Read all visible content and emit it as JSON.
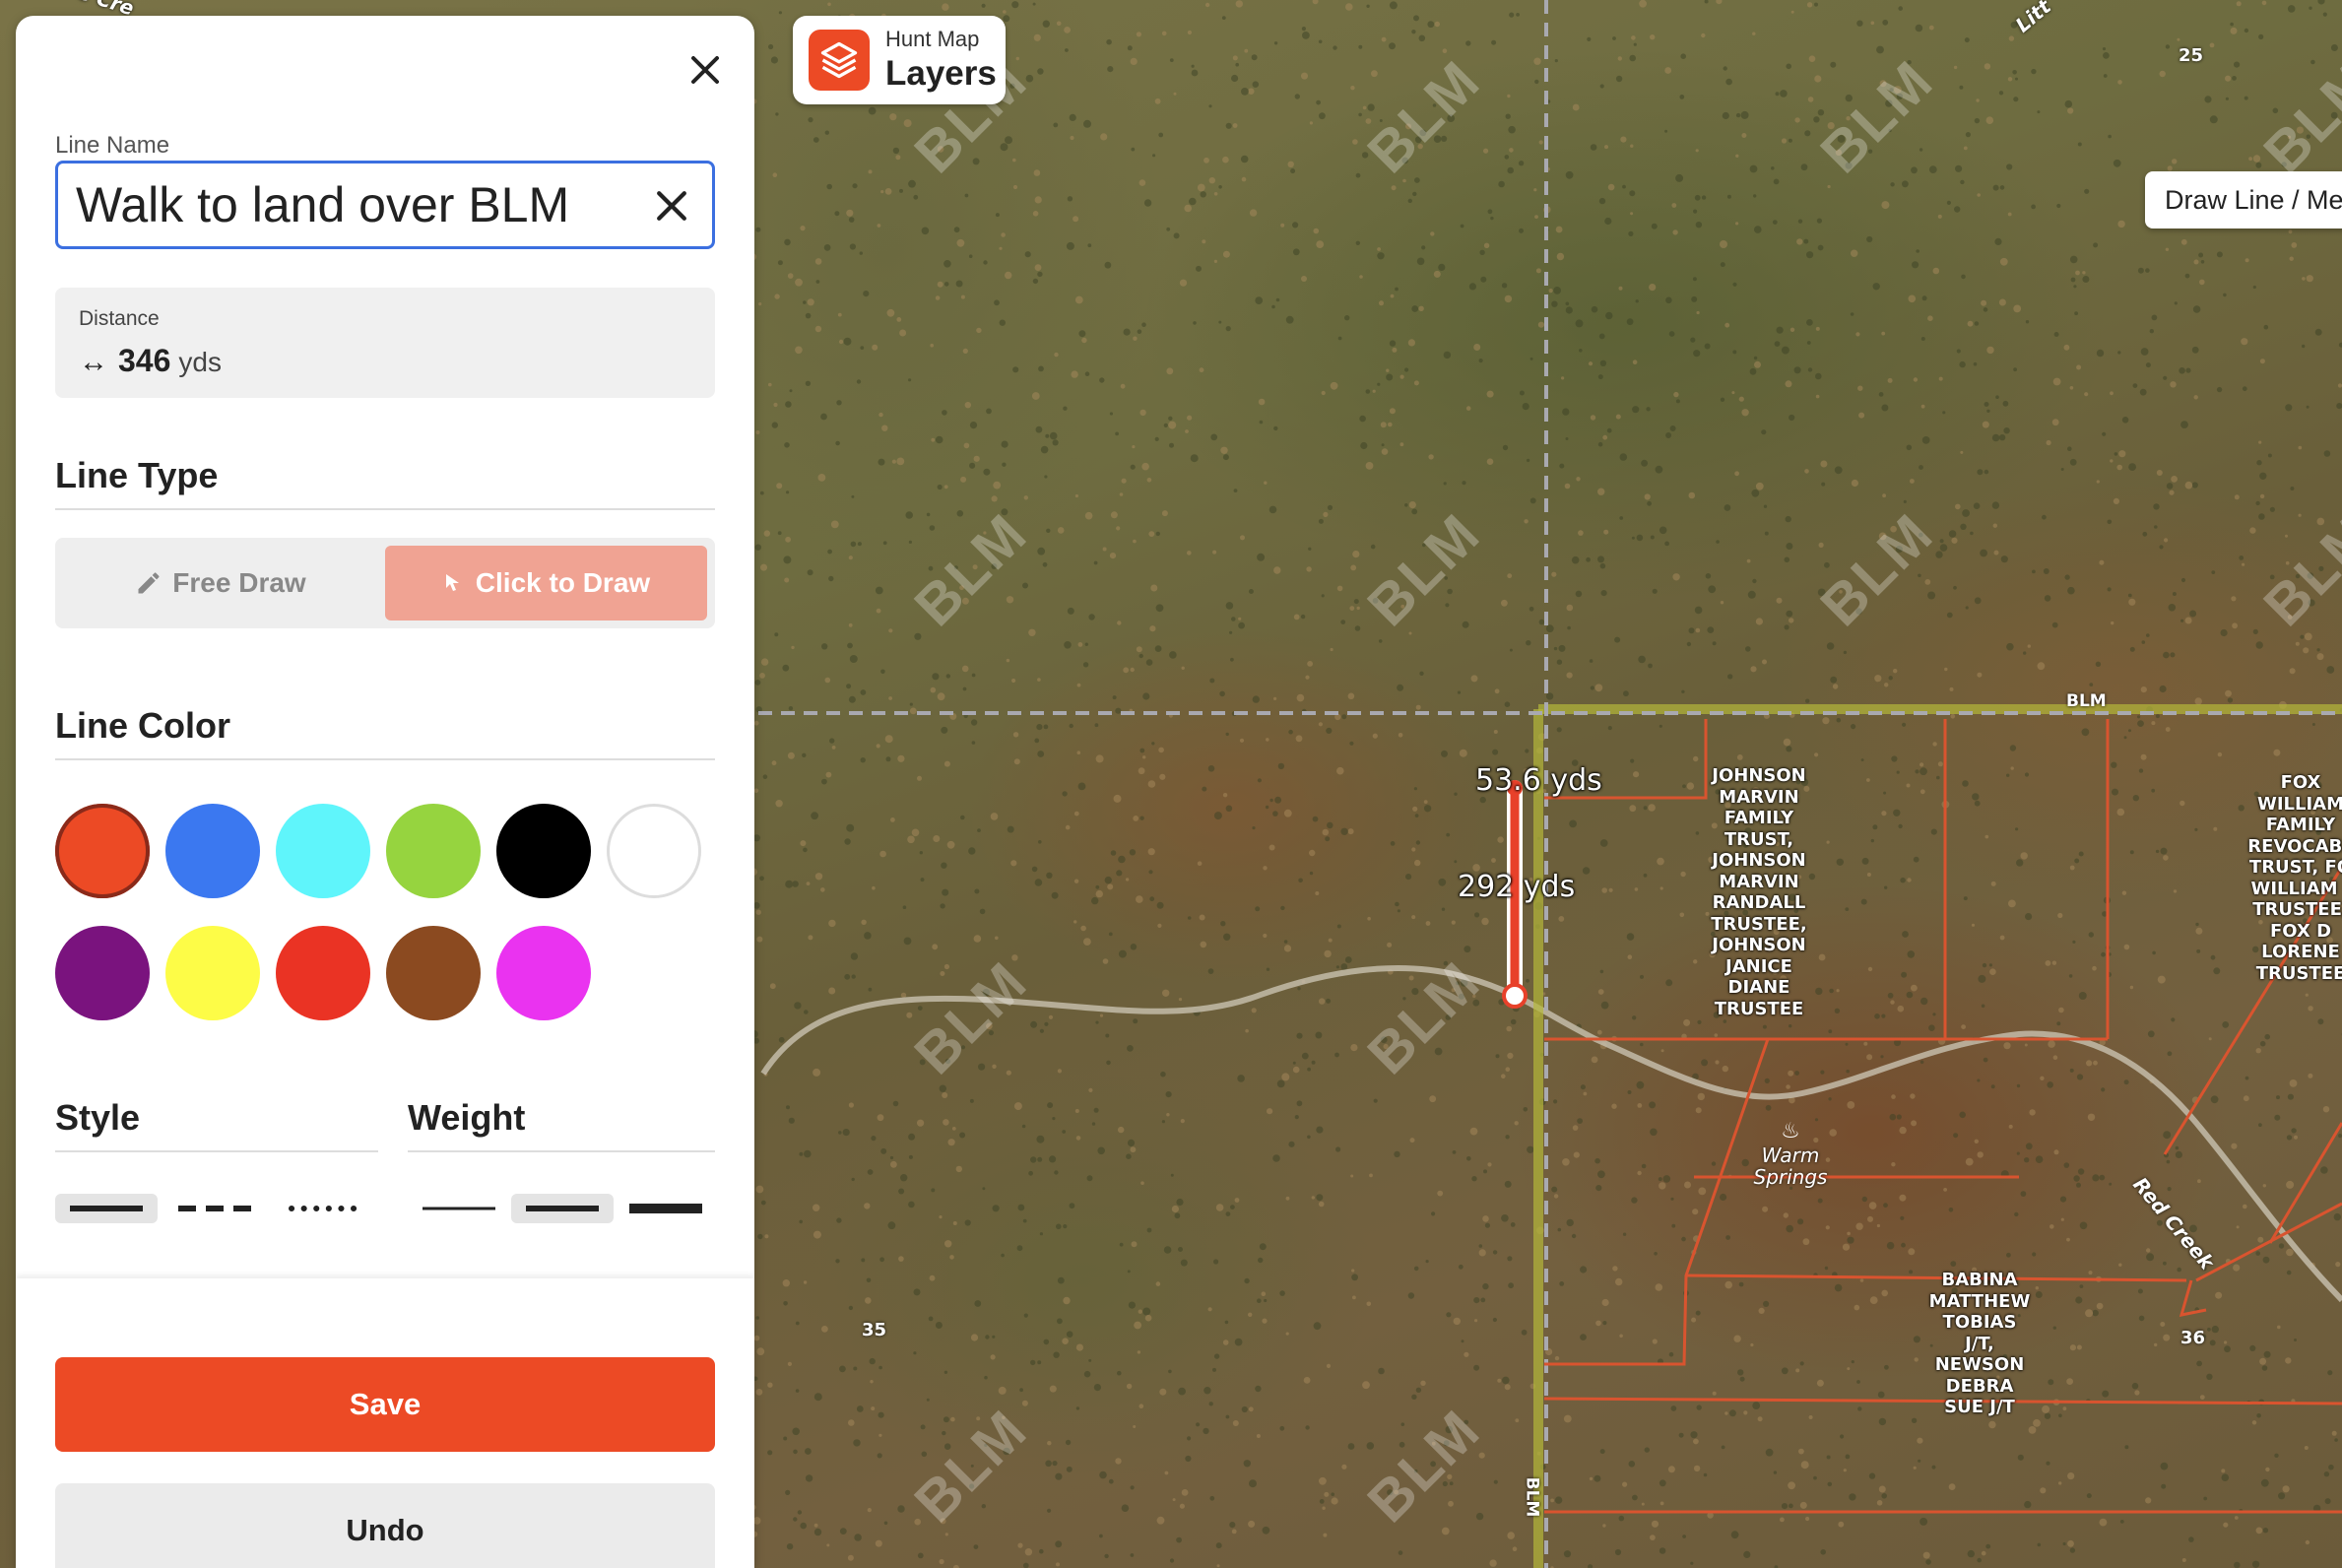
{
  "map": {
    "layers_button": {
      "title_small": "Hunt Map",
      "title_big": "Layers"
    },
    "draw_line_button": {
      "label": "Draw Line / Me"
    },
    "watermark_text": "BLM",
    "boundary_label_top": "BLM",
    "boundary_label_vertical": "BLM",
    "section_numbers": {
      "top_right": "25",
      "bottom_left": "35",
      "bottom_right": "36"
    },
    "parcels": {
      "johnson": "JOHNSON\nMARVIN\nFAMILY\nTRUST,\nJOHNSON\nMARVIN\nRANDALL\nTRUSTEE,\nJOHNSON\nJANICE\nDIANE\nTRUSTEE",
      "fox": "FOX\nWILLIAM\nFAMILY\nREVOCABL\nTRUST, FO\nWILLIAM I\nTRUSTEE,\nFOX D\nLORENE\nTRUSTEE",
      "babina": "BABINA\nMATTHEW\nTOBIAS\nJ/T,\nNEWSON\nDEBRA\nSUE J/T"
    },
    "place_label": "Warm\nSprings",
    "creek_label": "Red Creek",
    "creek_top_label": "Litt",
    "creek_top_left_label": "e Cre",
    "measurements": {
      "segment_top": "53.6 yds",
      "segment_main": "292 yds"
    },
    "colors": {
      "measure_line": "#e8412a",
      "parcel_line": "#d9542f",
      "boundary": "#b5b83a"
    }
  },
  "panel": {
    "line_name_label": "Line Name",
    "line_name_value": "Walk to land over BLM",
    "distance": {
      "label": "Distance",
      "arrow": "↔",
      "value": "346",
      "unit": "yds"
    },
    "line_type": {
      "heading": "Line Type",
      "options": [
        {
          "label": "Free Draw",
          "icon": "pencil-icon"
        },
        {
          "label": "Click to Draw",
          "icon": "cursor-icon"
        }
      ],
      "selected": "Click to Draw"
    },
    "line_color": {
      "heading": "Line Color",
      "swatches": [
        "#ec4a25",
        "#3b78f0",
        "#5ff5fb",
        "#96d43f",
        "#000000",
        "#ffffff",
        "#7a137e",
        "#fdfc47",
        "#ea3324",
        "#8b4a20",
        "#ea33f0"
      ],
      "selected": "#ec4a25"
    },
    "style": {
      "heading": "Style",
      "options": [
        "solid",
        "dashed",
        "dotted"
      ],
      "selected": "solid"
    },
    "weight": {
      "heading": "Weight",
      "options": [
        "thin",
        "medium",
        "thick"
      ],
      "selected": "medium"
    },
    "save_label": "Save",
    "undo_label": "Undo"
  }
}
